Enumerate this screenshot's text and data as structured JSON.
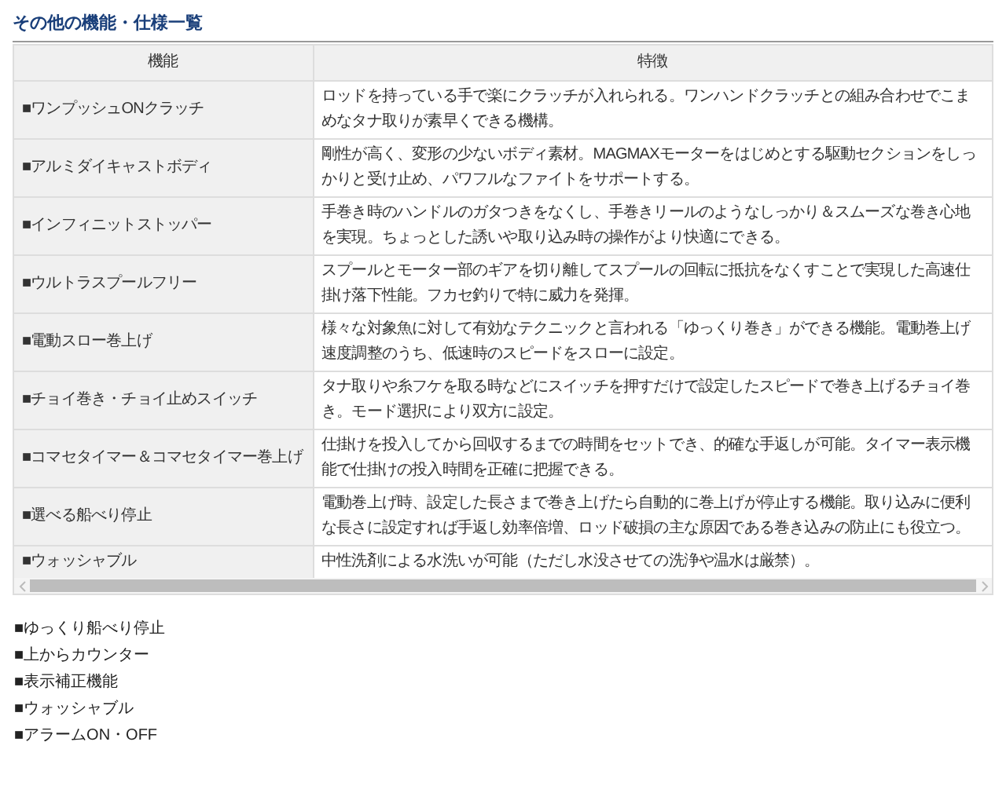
{
  "title": "その他の機能・仕様一覧",
  "table": {
    "columns": [
      "機能",
      "特徴"
    ],
    "rows": [
      {
        "feature": "■ワンプッシュONクラッチ",
        "description": "ロッドを持っている手で楽にクラッチが入れられる。ワンハンドクラッチとの組み合わせでこまめなタナ取りが素早くできる機構。"
      },
      {
        "feature": "■アルミダイキャストボディ",
        "description": "剛性が高く、変形の少ないボディ素材。MAGMAXモーターをはじめとする駆動セクションをしっかりと受け止め、パワフルなファイトをサポートする。"
      },
      {
        "feature": "■インフィニットストッパー",
        "description": "手巻き時のハンドルのガタつきをなくし、手巻きリールのようなしっかり＆スムーズな巻き心地を実現。ちょっとした誘いや取り込み時の操作がより快適にできる。"
      },
      {
        "feature": "■ウルトラスプールフリー",
        "description": "スプールとモーター部のギアを切り離してスプールの回転に抵抗をなくすことで実現した高速仕掛け落下性能。フカセ釣りで特に威力を発揮。"
      },
      {
        "feature": "■電動スロー巻上げ",
        "description": "様々な対象魚に対して有効なテクニックと言われる「ゆっくり巻き」ができる機能。電動巻上げ速度調整のうち、低速時のスピードをスローに設定。"
      },
      {
        "feature": "■チョイ巻き・チョイ止めスイッチ",
        "description": "タナ取りや糸フケを取る時などにスイッチを押すだけで設定したスピードで巻き上げるチョイ巻き。モード選択により双方に設定。"
      },
      {
        "feature": "■コマセタイマー＆コマセタイマー巻上げ",
        "description": "仕掛けを投入してから回収するまでの時間をセットでき、的確な手返しが可能。タイマー表示機能で仕掛けの投入時間を正確に把握できる。"
      },
      {
        "feature": "■選べる船べり停止",
        "description": "電動巻上げ時、設定した長さまで巻き上げたら自動的に巻上げが停止する機能。取り込みに便利な長さに設定すれば手返し効率倍増、ロッド破損の主な原因である巻き込みの防止にも役立つ。"
      },
      {
        "feature": "■ウォッシャブル",
        "description": "中性洗剤による水洗いが可能（ただし水没させての洗浄や温水は厳禁）。"
      }
    ]
  },
  "list": [
    "■ゆっくり船べり停止",
    "■上からカウンター",
    "■表示補正機能",
    "■ウォッシャブル",
    "■アラームON・OFF"
  ]
}
